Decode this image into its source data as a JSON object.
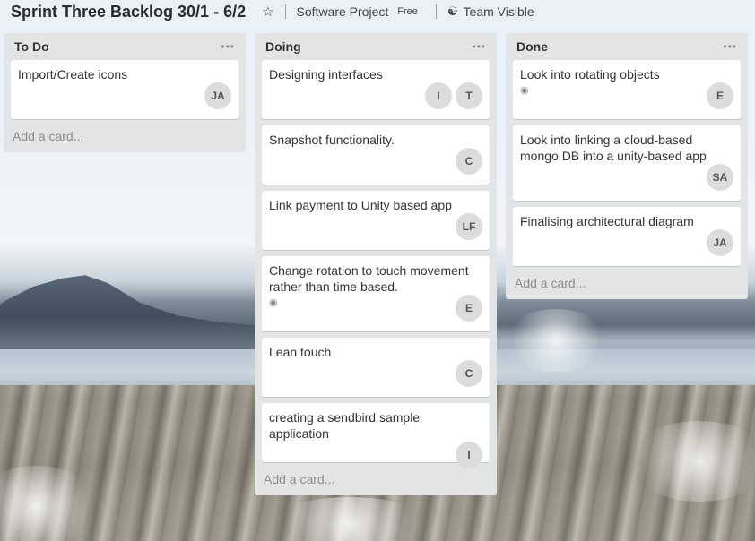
{
  "header": {
    "board_title": "Sprint Three Backlog 30/1 - 6/2",
    "team_name": "Software Project",
    "plan_badge": "Free",
    "visibility": "Team Visible"
  },
  "lists": [
    {
      "title": "To Do",
      "add_card_label": "Add a card...",
      "cards": [
        {
          "title": "Import/Create icons",
          "watched": false,
          "members": [
            "JA"
          ]
        }
      ]
    },
    {
      "title": "Doing",
      "add_card_label": "Add a card...",
      "cards": [
        {
          "title": "Designing interfaces",
          "watched": false,
          "members": [
            "I",
            "T"
          ]
        },
        {
          "title": "Snapshot functionality.",
          "watched": false,
          "members": [
            "C"
          ]
        },
        {
          "title": "Link payment to Unity based app",
          "watched": false,
          "members": [
            "LF"
          ]
        },
        {
          "title": "Change rotation to touch movement rather than time based.",
          "watched": true,
          "members": [
            "E"
          ]
        },
        {
          "title": "Lean touch",
          "watched": false,
          "members": [
            "C"
          ]
        },
        {
          "title": "creating a sendbird sample application",
          "watched": false,
          "members": [
            "I"
          ]
        }
      ]
    },
    {
      "title": "Done",
      "add_card_label": "Add a card...",
      "cards": [
        {
          "title": "Look into rotating objects",
          "watched": true,
          "members": [
            "E"
          ]
        },
        {
          "title": "Look into linking a cloud-based mongo DB into a unity-based app",
          "watched": false,
          "members": [
            "SA"
          ]
        },
        {
          "title": "Finalising architectural diagram",
          "watched": false,
          "members": [
            "JA"
          ]
        }
      ]
    }
  ],
  "icons": {
    "star": "star-icon",
    "visibility": "team-visibility-icon",
    "list_menu": "more-horizontal-icon",
    "watch": "eye-icon"
  }
}
